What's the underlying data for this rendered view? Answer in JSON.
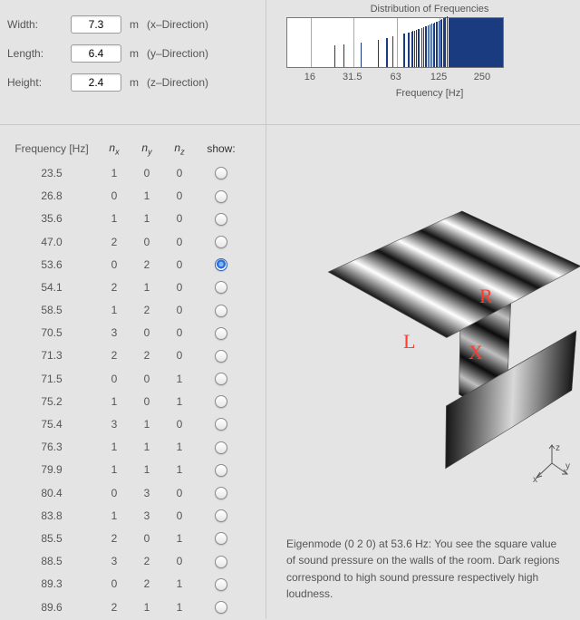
{
  "dims": {
    "width": {
      "label": "Width:",
      "value": "7.3",
      "unit": "m",
      "dir": "(x–Direction)"
    },
    "length": {
      "label": "Length:",
      "value": "6.4",
      "unit": "m",
      "dir": "(y–Direction)"
    },
    "height": {
      "label": "Height:",
      "value": "2.4",
      "unit": "m",
      "dir": "(z–Direction)"
    }
  },
  "chart_data": {
    "type": "rug-histogram",
    "title": "Distribution of Frequencies",
    "xlabel": "Frequency [Hz]",
    "xscale": "log",
    "xlim_hz": [
      11,
      354
    ],
    "xticks_hz": [
      16,
      31.5,
      63,
      125,
      250
    ],
    "gridlines_hz": [
      16,
      31.5,
      63,
      125,
      250
    ],
    "dense_fill_above_hz": 145,
    "values_hz": [
      23.5,
      26.8,
      35.6,
      47.0,
      53.6,
      54.1,
      58.5,
      70.5,
      71.3,
      71.5,
      75.2,
      75.4,
      76.3,
      79.9,
      80.4,
      83.8,
      85.5,
      88.5,
      89.3,
      89.6,
      93.8,
      94.1,
      96.4,
      98.9,
      101.2,
      104.1,
      105.8,
      107.3,
      110.3,
      112.7,
      114.9,
      117.1,
      120.4,
      123.5,
      126.2,
      129.0,
      131.8,
      134.6,
      137.1,
      140.5
    ]
  },
  "table": {
    "headers": {
      "f": "Frequency [Hz]",
      "nx": "n",
      "ny": "n",
      "nz": "n",
      "show": "show:"
    },
    "subscripts": {
      "nx": "x",
      "ny": "y",
      "nz": "z"
    },
    "selected_index": 4,
    "rows": [
      {
        "f": "23.5",
        "nx": "1",
        "ny": "0",
        "nz": "0"
      },
      {
        "f": "26.8",
        "nx": "0",
        "ny": "1",
        "nz": "0"
      },
      {
        "f": "35.6",
        "nx": "1",
        "ny": "1",
        "nz": "0"
      },
      {
        "f": "47.0",
        "nx": "2",
        "ny": "0",
        "nz": "0"
      },
      {
        "f": "53.6",
        "nx": "0",
        "ny": "2",
        "nz": "0"
      },
      {
        "f": "54.1",
        "nx": "2",
        "ny": "1",
        "nz": "0"
      },
      {
        "f": "58.5",
        "nx": "1",
        "ny": "2",
        "nz": "0"
      },
      {
        "f": "70.5",
        "nx": "3",
        "ny": "0",
        "nz": "0"
      },
      {
        "f": "71.3",
        "nx": "2",
        "ny": "2",
        "nz": "0"
      },
      {
        "f": "71.5",
        "nx": "0",
        "ny": "0",
        "nz": "1"
      },
      {
        "f": "75.2",
        "nx": "1",
        "ny": "0",
        "nz": "1"
      },
      {
        "f": "75.4",
        "nx": "3",
        "ny": "1",
        "nz": "0"
      },
      {
        "f": "76.3",
        "nx": "1",
        "ny": "1",
        "nz": "1"
      },
      {
        "f": "79.9",
        "nx": "1",
        "ny": "1",
        "nz": "1"
      },
      {
        "f": "80.4",
        "nx": "0",
        "ny": "3",
        "nz": "0"
      },
      {
        "f": "83.8",
        "nx": "1",
        "ny": "3",
        "nz": "0"
      },
      {
        "f": "85.5",
        "nx": "2",
        "ny": "0",
        "nz": "1"
      },
      {
        "f": "88.5",
        "nx": "3",
        "ny": "2",
        "nz": "0"
      },
      {
        "f": "89.3",
        "nx": "0",
        "ny": "2",
        "nz": "1"
      },
      {
        "f": "89.6",
        "nx": "2",
        "ny": "1",
        "nz": "1"
      }
    ]
  },
  "render": {
    "markers": {
      "L": "L",
      "R": "R",
      "X": "X"
    },
    "axis_labels": {
      "x": "x",
      "y": "y",
      "z": "z"
    },
    "caption": "Eigenmode (0 2 0) at 53.6 Hz: You see the square value of sound pressure on the walls of the room. Dark regions correspond to high sound pressure respectively high loudness."
  }
}
